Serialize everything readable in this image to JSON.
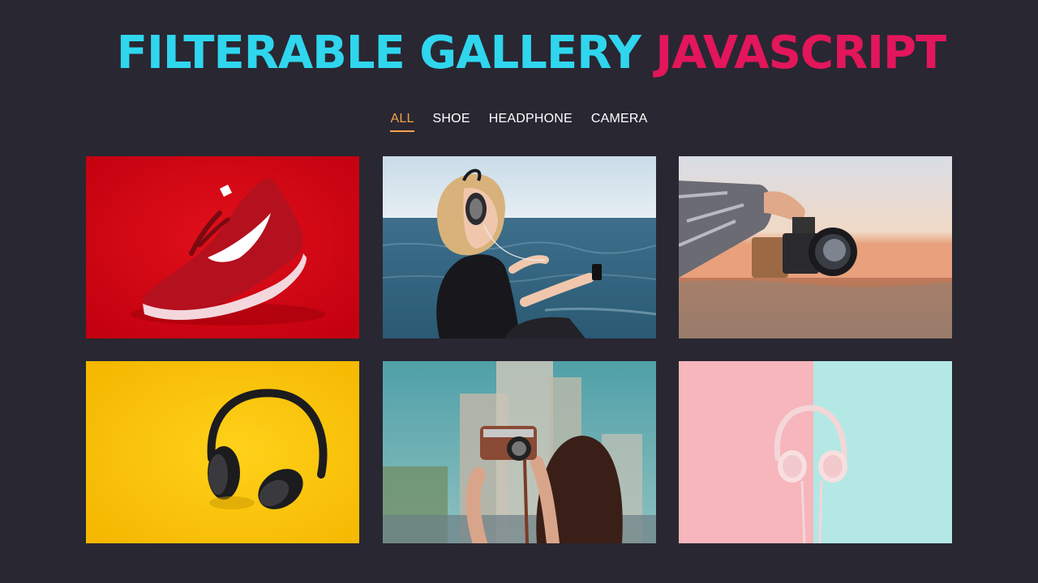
{
  "header": {
    "title_part1": "FILTERABLE GALLERY",
    "title_part2": "JAVASCRIPT"
  },
  "filters": [
    {
      "label": "ALL",
      "active": true
    },
    {
      "label": "SHOE",
      "active": false
    },
    {
      "label": "HEADPHONE",
      "active": false
    },
    {
      "label": "CAMERA",
      "active": false
    }
  ],
  "gallery": [
    {
      "category": "shoe",
      "subject": "red-sneaker-icon"
    },
    {
      "category": "headphone",
      "subject": "woman-headphones-sea-icon"
    },
    {
      "category": "camera",
      "subject": "hand-holding-camera-icon"
    },
    {
      "category": "headphone",
      "subject": "black-headphones-yellow-icon"
    },
    {
      "category": "camera",
      "subject": "woman-camera-city-icon"
    },
    {
      "category": "headphone",
      "subject": "pink-headphones-pastel-icon"
    }
  ],
  "colors": {
    "background": "#292732",
    "title_cyan": "#2fd6ee",
    "title_pink": "#e3165b",
    "active_filter": "#f5a34a"
  }
}
